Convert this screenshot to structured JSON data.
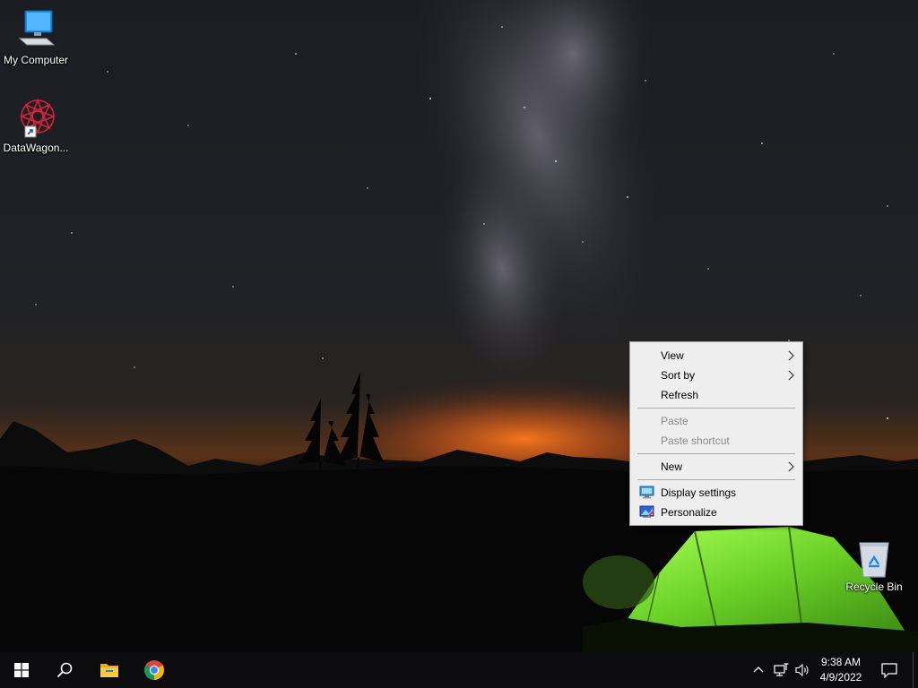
{
  "desktop": {
    "icons": [
      {
        "label": "My Computer",
        "icon": "computer-icon"
      },
      {
        "label": "DataWagon...",
        "icon": "datawagon-icon"
      },
      {
        "label": "Recycle Bin",
        "icon": "recycle-bin-icon"
      }
    ]
  },
  "context_menu": {
    "items": [
      {
        "label": "View",
        "enabled": true,
        "submenu": true
      },
      {
        "label": "Sort by",
        "enabled": true,
        "submenu": true
      },
      {
        "label": "Refresh",
        "enabled": true
      },
      {
        "label": "Paste",
        "enabled": false
      },
      {
        "label": "Paste shortcut",
        "enabled": false
      },
      {
        "label": "New",
        "enabled": true,
        "submenu": true
      },
      {
        "label": "Display settings",
        "enabled": true,
        "icon": "display-settings-icon"
      },
      {
        "label": "Personalize",
        "enabled": true,
        "icon": "personalize-icon"
      }
    ]
  },
  "taskbar": {
    "pinned": [
      "start-icon",
      "search-icon",
      "file-explorer-icon",
      "chrome-icon"
    ],
    "tray": {
      "time": "9:38 AM",
      "date": "4/9/2022",
      "icons": [
        "chevron-up-icon",
        "network-icon",
        "volume-icon",
        "notification-icon"
      ]
    }
  },
  "colors": {
    "accent": "#0078d7",
    "menu_bg": "#eeeeee",
    "taskbar_bg": "#0c0c0e",
    "tent_green": "#7fe33a"
  }
}
